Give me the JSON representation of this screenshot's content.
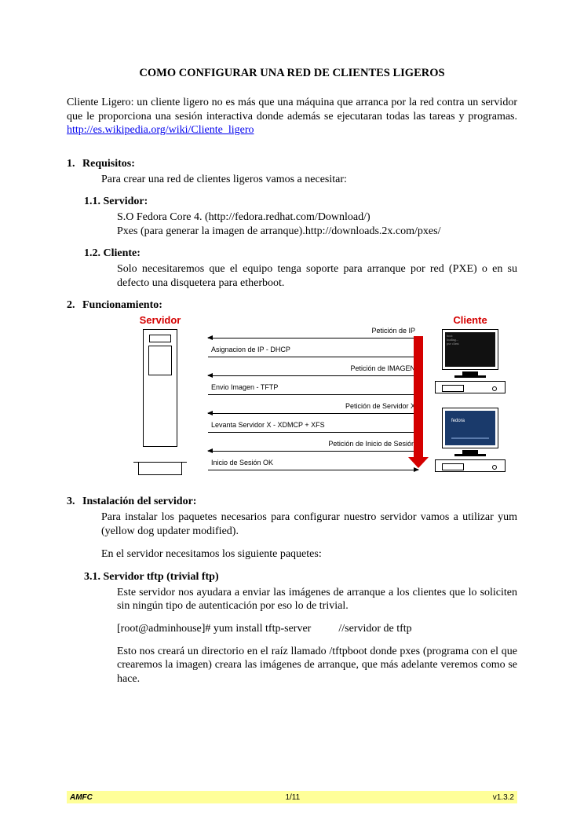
{
  "title": "COMO CONFIGURAR UNA RED DE CLIENTES LIGEROS",
  "intro": {
    "text": "Cliente Ligero: un cliente ligero no es más que una máquina que arranca por la red contra un servidor que le proporciona una sesión interactiva donde además se ejecutaran todas las tareas y programas. ",
    "link": "http://es.wikipedia.org/wiki/Cliente_ligero"
  },
  "s1": {
    "num": "1.",
    "h": "Requisitos:",
    "p": "Para crear una red de clientes ligeros vamos a necesitar:",
    "s11": {
      "num": "1.1.",
      "h": "Servidor:",
      "l1": "S.O Fedora Core 4. (http://fedora.redhat.com/Download/)",
      "l2": "Pxes (para generar la imagen de arranque).http://downloads.2x.com/pxes/"
    },
    "s12": {
      "num": "1.2.",
      "h": "Cliente:",
      "p": "Solo necesitaremos que el equipo tenga soporte para arranque por red (PXE) o en su defecto una disquetera para etherboot."
    }
  },
  "s2": {
    "num": "2.",
    "h": "Funcionamiento:",
    "servidor": "Servidor",
    "cliente": "Cliente",
    "flows": [
      {
        "dir": "left",
        "side": "right",
        "label": "Petición de IP"
      },
      {
        "dir": "right",
        "side": "left",
        "label": "Asignacion de IP - DHCP"
      },
      {
        "dir": "left",
        "side": "right",
        "label": "Petición de IMAGEN"
      },
      {
        "dir": "right",
        "side": "left",
        "label": "Envio Imagen - TFTP"
      },
      {
        "dir": "left",
        "side": "right",
        "label": "Petición de Servidor X"
      },
      {
        "dir": "right",
        "side": "left",
        "label": "Levanta Servidor X - XDMCP + XFS"
      },
      {
        "dir": "left",
        "side": "right",
        "label": "Petición de Inicio de Sesión"
      },
      {
        "dir": "right",
        "side": "left",
        "label": "Inicio de Sesión OK"
      }
    ]
  },
  "s3": {
    "num": "3.",
    "h": "Instalación del servidor:",
    "p1": "Para instalar los paquetes necesarios para configurar nuestro servidor vamos a utilizar yum (yellow dog updater modified).",
    "p2": "En el servidor necesitamos los siguiente paquetes:",
    "s31": {
      "num": "3.1.",
      "h": "Servidor tftp (trivial ftp)",
      "p1": "Este servidor nos ayudara a enviar las imágenes de arranque a los clientes que lo soliciten sin ningún tipo de autenticación por eso lo de trivial.",
      "cmd": "[root@adminhouse]# yum install tftp-server",
      "cmdc": "//servidor de tftp",
      "p2": "Esto nos creará un directorio en el raíz llamado /tftpboot donde pxes (programa con el que crearemos la imagen) creara las imágenes de arranque, que más adelante veremos como se hace."
    }
  },
  "footer": {
    "left": "AMFC",
    "center": "1/11",
    "right": "v1.3.2"
  }
}
